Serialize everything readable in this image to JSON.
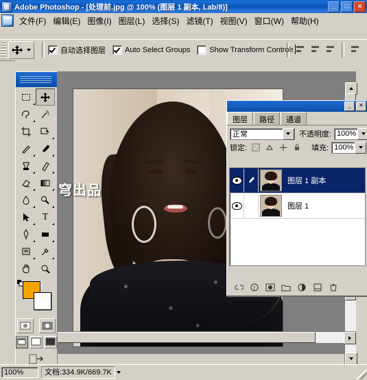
{
  "window": {
    "title": "Adobe Photoshop - [处理前.jpg @ 100% (图层 1 副本, Lab/8)]",
    "buttons": {
      "minimize": "_",
      "maximize": "□",
      "close": "✕"
    },
    "inner_buttons": {
      "minimize": "_",
      "restore": "❐",
      "close": "✕"
    }
  },
  "menubar": {
    "items": [
      {
        "label": "文件(F)",
        "name": "menu-file"
      },
      {
        "label": "编辑(E)",
        "name": "menu-edit"
      },
      {
        "label": "图像(I)",
        "name": "menu-image"
      },
      {
        "label": "图层(L)",
        "name": "menu-layer"
      },
      {
        "label": "选择(S)",
        "name": "menu-select"
      },
      {
        "label": "滤镜(T)",
        "name": "menu-filter"
      },
      {
        "label": "视图(V)",
        "name": "menu-view"
      },
      {
        "label": "窗口(W)",
        "name": "menu-window"
      },
      {
        "label": "帮助(H)",
        "name": "menu-help"
      }
    ]
  },
  "options_bar": {
    "tool_preset_tooltip": "移动工具",
    "auto_select_layer": {
      "label": "自动选择图层",
      "checked": true
    },
    "auto_select_groups": {
      "label": "Auto Select Groups",
      "checked": true
    },
    "show_transform_controls": {
      "label": "Show Transform Controls",
      "checked": false
    }
  },
  "document": {
    "watermark": "宁夜苍穹出品"
  },
  "toolbox": {
    "tools": [
      {
        "name": "marquee-tool",
        "glyph": "▭"
      },
      {
        "name": "move-tool",
        "glyph": "✥"
      },
      {
        "name": "lasso-tool",
        "glyph": "✑"
      },
      {
        "name": "magic-wand-tool",
        "glyph": "✦"
      },
      {
        "name": "crop-tool",
        "glyph": "⌗"
      },
      {
        "name": "slice-tool",
        "glyph": "⊿"
      },
      {
        "name": "healing-brush-tool",
        "glyph": "✒"
      },
      {
        "name": "brush-tool",
        "glyph": "🖌"
      },
      {
        "name": "clone-stamp-tool",
        "glyph": "⚑"
      },
      {
        "name": "history-brush-tool",
        "glyph": "✎"
      },
      {
        "name": "eraser-tool",
        "glyph": "▰"
      },
      {
        "name": "gradient-tool",
        "glyph": "▤"
      },
      {
        "name": "blur-tool",
        "glyph": "◠"
      },
      {
        "name": "dodge-tool",
        "glyph": "○"
      },
      {
        "name": "path-selection-tool",
        "glyph": "➤"
      },
      {
        "name": "type-tool",
        "glyph": "T"
      },
      {
        "name": "pen-tool",
        "glyph": "✐"
      },
      {
        "name": "shape-tool",
        "glyph": "▬"
      },
      {
        "name": "notes-tool",
        "glyph": "❏"
      },
      {
        "name": "eyedropper-tool",
        "glyph": "⚲"
      },
      {
        "name": "hand-tool",
        "glyph": "✋"
      },
      {
        "name": "zoom-tool",
        "glyph": "🔍"
      }
    ],
    "foreground_color": "#f5a300",
    "background_color": "#ffffff",
    "quick_mask": [
      "standard-mask-mode",
      "quick-mask-mode"
    ],
    "screen_modes": [
      "standard-screen-mode",
      "full-screen-menubar-mode",
      "full-screen-mode"
    ],
    "jump_to": "ImageReady"
  },
  "layers_palette": {
    "tabs": [
      {
        "label": "图层",
        "name": "tab-layers",
        "active": true
      },
      {
        "label": "路径",
        "name": "tab-paths",
        "active": false
      },
      {
        "label": "通道",
        "name": "tab-channels",
        "active": false
      }
    ],
    "blend_mode": "正常",
    "opacity_label": "不透明度:",
    "opacity_value": "100%",
    "lock_label": "锁定:",
    "fill_label": "填充:",
    "fill_value": "100%",
    "layers": [
      {
        "name": "图层 1 副本",
        "visible": true,
        "selected": true
      },
      {
        "name": "图层 1",
        "visible": true,
        "selected": false
      }
    ],
    "bottom_buttons": [
      {
        "name": "link-layers-button",
        "glyph": "⛓"
      },
      {
        "name": "layer-style-button",
        "glyph": "ƒ"
      },
      {
        "name": "layer-mask-button",
        "glyph": "◑"
      },
      {
        "name": "new-group-button",
        "glyph": "▭"
      },
      {
        "name": "adjustment-layer-button",
        "glyph": "◒"
      },
      {
        "name": "new-layer-button",
        "glyph": "⬓"
      },
      {
        "name": "delete-layer-button",
        "glyph": "🗑"
      }
    ]
  },
  "status_bar": {
    "zoom": "100%",
    "info": "文档:334.9K/669.7K"
  }
}
